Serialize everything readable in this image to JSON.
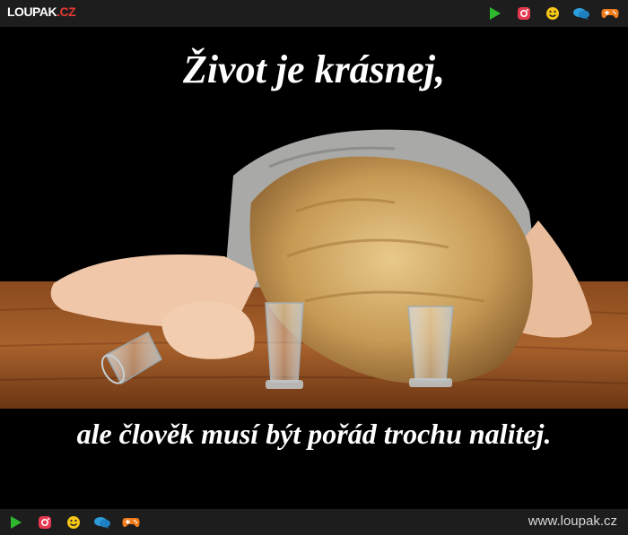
{
  "header": {
    "logo_main": "LOUPAK",
    "logo_tld": ".CZ",
    "icons": [
      "play-icon",
      "instagram-icon",
      "smiley-icon",
      "chat-icon",
      "gamepad-icon"
    ]
  },
  "meme": {
    "top_text": "Život je krásnej,",
    "bottom_text": "ale člověk musí být pořád trochu nalitej."
  },
  "footer": {
    "icons": [
      "play-icon",
      "instagram-icon",
      "smiley-icon",
      "chat-icon",
      "gamepad-icon"
    ],
    "site_url": "www.loupak.cz"
  },
  "colors": {
    "bar_bg": "#1d1d1d",
    "play": "#2eb82e",
    "instagram": "#e53950",
    "smiley": "#f5c518",
    "chat": "#2d9cdb",
    "gamepad": "#f07c1e",
    "logo_accent": "#e53935"
  }
}
